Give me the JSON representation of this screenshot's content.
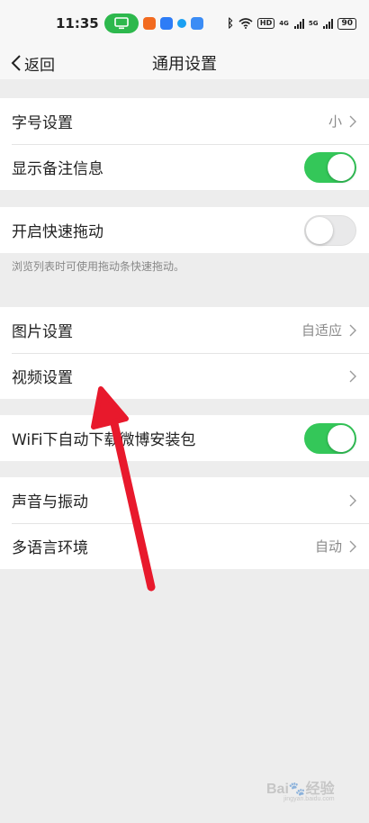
{
  "status": {
    "time": "11:35",
    "hd": "HD",
    "net1": "4G",
    "net2": "5G",
    "battery": "90"
  },
  "nav": {
    "back_label": "返回",
    "title": "通用设置"
  },
  "settings": {
    "font_size": {
      "label": "字号设置",
      "value": "小"
    },
    "show_remark": {
      "label": "显示备注信息",
      "on": true
    },
    "quick_drag": {
      "label": "开启快速拖动",
      "on": false,
      "hint": "浏览列表时可使用拖动条快速拖动。"
    },
    "image": {
      "label": "图片设置",
      "value": "自适应"
    },
    "video": {
      "label": "视频设置"
    },
    "wifi_download": {
      "label": "WiFi下自动下载微博安装包",
      "on": true
    },
    "sound": {
      "label": "声音与振动"
    },
    "language": {
      "label": "多语言环境",
      "value": "自动"
    }
  },
  "colors": {
    "toggle_on": "#34c759",
    "annotation_arrow": "#e8192c"
  },
  "watermark": {
    "text": "Bai",
    "paw": "🐾",
    "text2": "经验",
    "sub": "jingyan.baidu.com"
  }
}
